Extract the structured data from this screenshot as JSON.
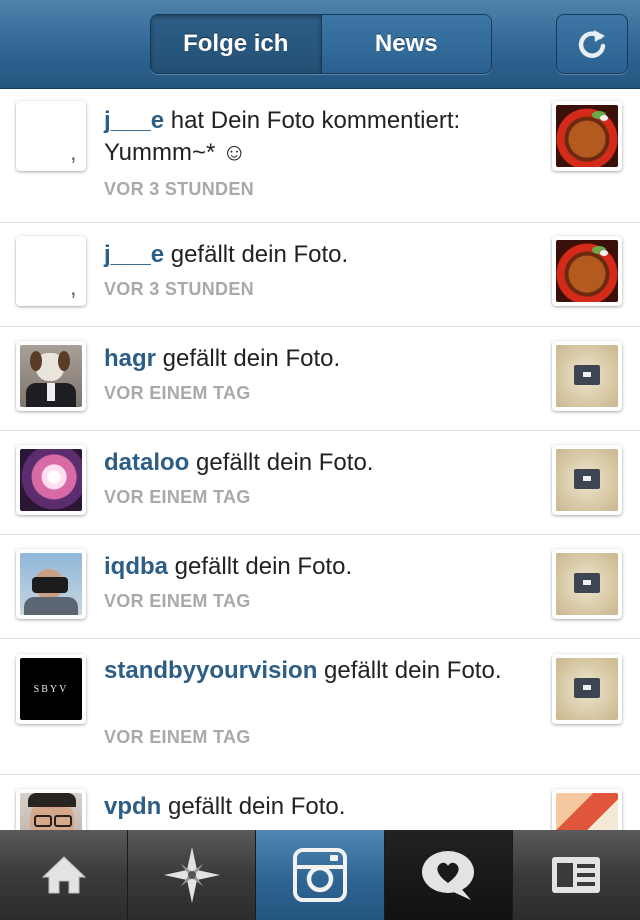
{
  "header": {
    "tabs": [
      {
        "label": "Folge ich",
        "active": true
      },
      {
        "label": "News",
        "active": false
      }
    ],
    "refresh_icon": "refresh-icon"
  },
  "feed": [
    {
      "user": "j___e",
      "action": " hat Dein Foto kommentiert: Yummm~* ☺",
      "time": "VOR 3 STUNDEN",
      "avatar": "blank-avatar",
      "thumbnail": "food-photo"
    },
    {
      "user": "j___e",
      "action": " gefällt dein Foto.",
      "time": "VOR 3 STUNDEN",
      "avatar": "blank-avatar",
      "thumbnail": "food-photo"
    },
    {
      "user": "hagr",
      "action": " gefällt dein Foto.",
      "time": "VOR EINEM TAG",
      "avatar": "dog-in-suit-avatar",
      "thumbnail": "wallet-photo"
    },
    {
      "user": "dataloo",
      "action": " gefällt dein Foto.",
      "time": "VOR EINEM TAG",
      "avatar": "sunburst-avatar",
      "thumbnail": "wallet-photo"
    },
    {
      "user": "iqdba",
      "action": " gefällt dein Foto.",
      "time": "VOR EINEM TAG",
      "avatar": "photographer-avatar",
      "thumbnail": "wallet-photo"
    },
    {
      "user": "standbyyourvision",
      "action": " gefällt dein Foto.",
      "time": "VOR EINEM TAG",
      "avatar": "sbyv-logo-avatar",
      "avatar_text": "SBYV",
      "thumbnail": "wallet-photo"
    },
    {
      "user": "vpdn",
      "action": " gefällt dein Foto.",
      "time": "",
      "avatar": "glasses-man-avatar",
      "thumbnail": "colorful-photo"
    }
  ],
  "tabbar": [
    {
      "name": "home",
      "icon": "home-icon"
    },
    {
      "name": "explore",
      "icon": "compass-star-icon"
    },
    {
      "name": "camera",
      "icon": "camera-icon"
    },
    {
      "name": "activity",
      "icon": "heart-bubble-icon"
    },
    {
      "name": "profile",
      "icon": "profile-card-icon"
    }
  ]
}
